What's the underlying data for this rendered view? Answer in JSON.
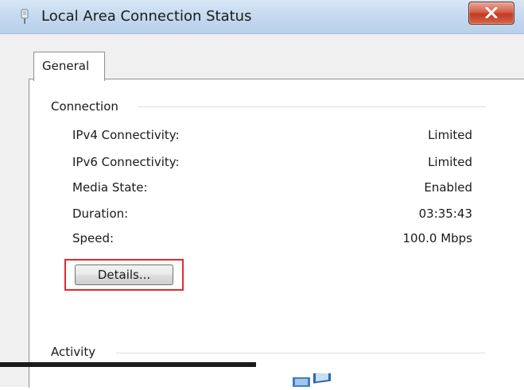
{
  "window": {
    "title": "Local Area Connection Status"
  },
  "tabs": [
    {
      "label": "General"
    }
  ],
  "connection": {
    "group_label": "Connection",
    "rows": [
      {
        "label": "IPv4 Connectivity:",
        "value": "Limited"
      },
      {
        "label": "IPv6 Connectivity:",
        "value": "Limited"
      },
      {
        "label": "Media State:",
        "value": "Enabled"
      },
      {
        "label": "Duration:",
        "value": "03:35:43"
      },
      {
        "label": "Speed:",
        "value": "100.0 Mbps"
      }
    ],
    "details_button": "Details..."
  },
  "activity": {
    "group_label": "Activity"
  },
  "colors": {
    "highlight": "#e8262d",
    "close_button": "#c23a22",
    "titlebar": "#c6daf0"
  },
  "icons": {
    "title": "network-connection-icon",
    "close": "close-icon",
    "activity": "network-computers-icon"
  }
}
